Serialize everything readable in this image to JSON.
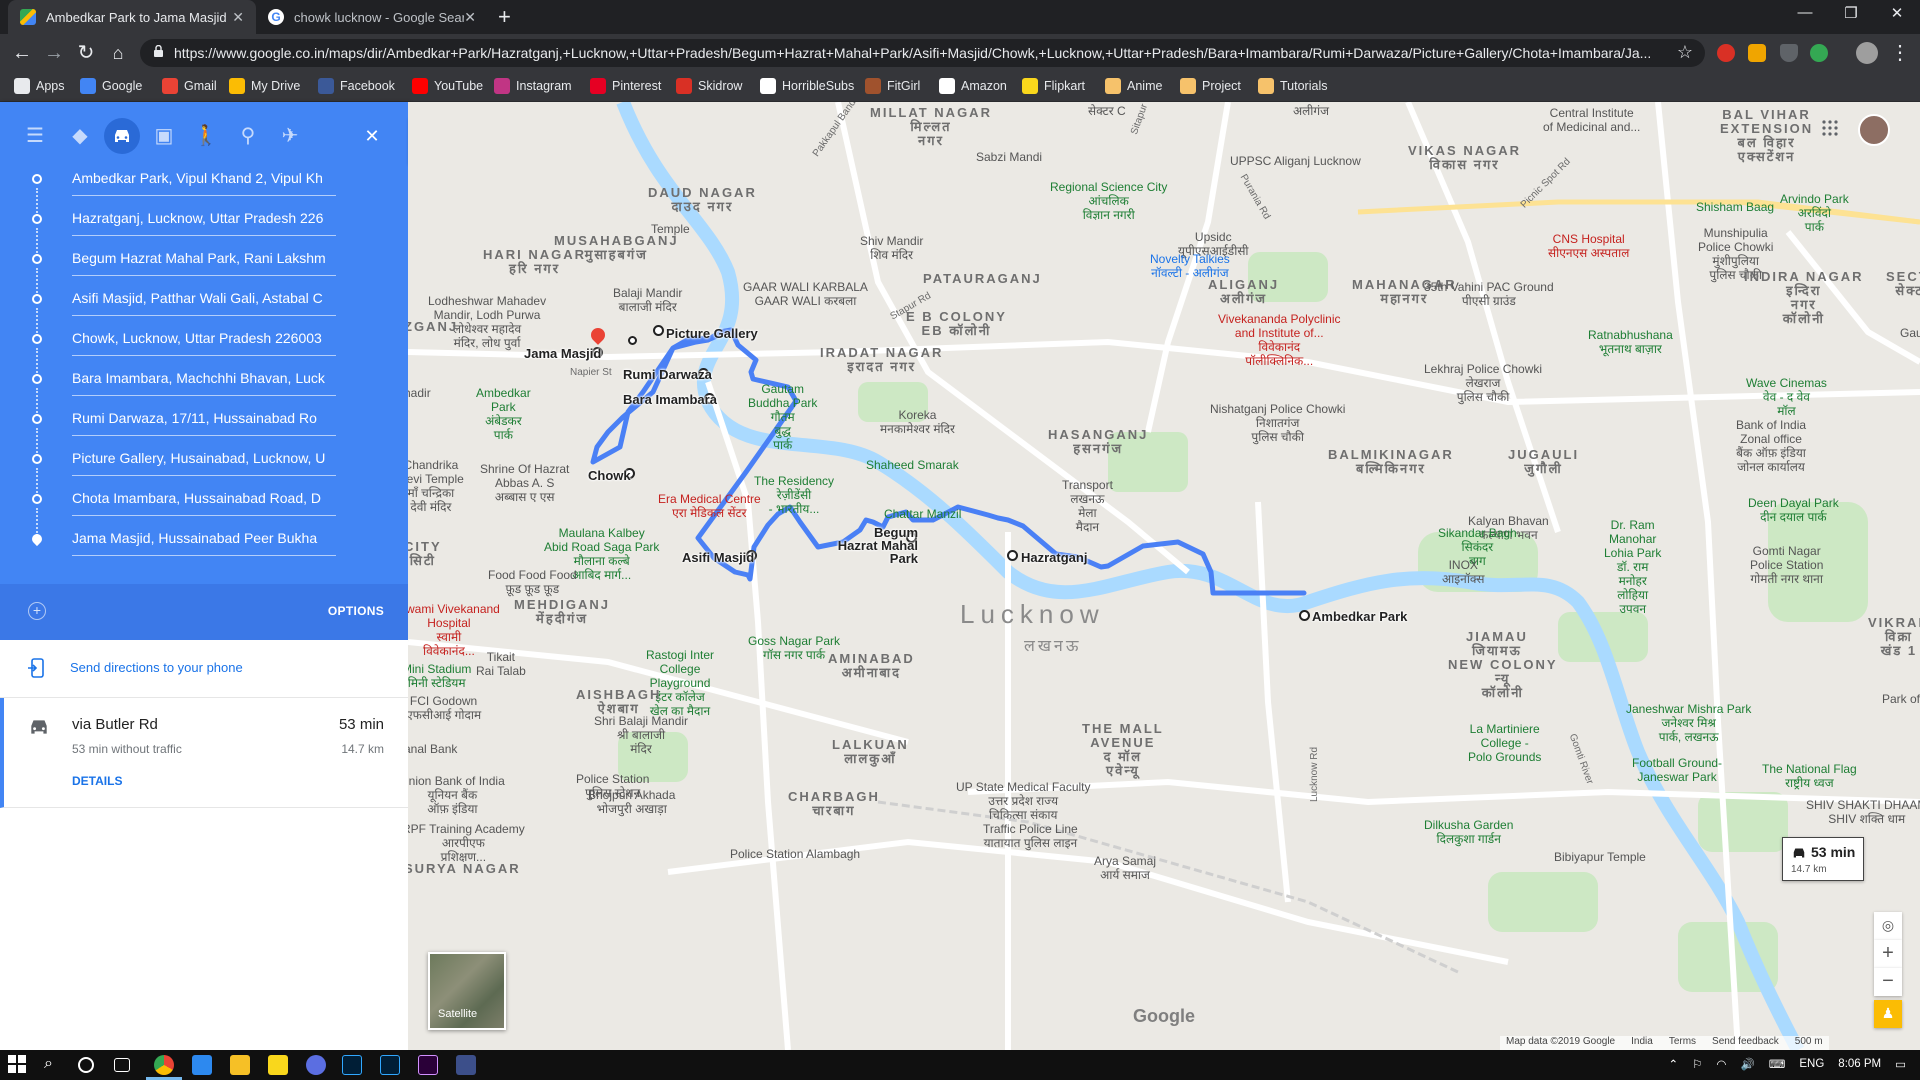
{
  "browser": {
    "tabs": [
      {
        "title": "Ambedkar Park to Jama Masjid -",
        "icon": "google-maps-icon",
        "active": true
      },
      {
        "title": "chowk lucknow - Google Search",
        "icon": "google-icon",
        "active": false
      }
    ],
    "new_tab": "+",
    "url": "https://www.google.co.in/maps/dir/Ambedkar+Park/Hazratganj,+Lucknow,+Uttar+Pradesh/Begum+Hazrat+Mahal+Park/Asifi+Masjid/Chowk,+Lucknow,+Uttar+Pradesh/Bara+Imambara/Rumi+Darwaza/Picture+Gallery/Chota+Imambara/Ja...",
    "bookmarks": [
      {
        "label": "Apps",
        "color": "#e8eaed"
      },
      {
        "label": "Google",
        "color": "#4285f4"
      },
      {
        "label": "Gmail",
        "color": "#ea4335"
      },
      {
        "label": "My Drive",
        "color": "#fbbc04"
      },
      {
        "label": "Facebook",
        "color": "#3b5998"
      },
      {
        "label": "YouTube",
        "color": "#ff0000"
      },
      {
        "label": "Instagram",
        "color": "#c13584"
      },
      {
        "label": "Pinterest",
        "color": "#e60023"
      },
      {
        "label": "Skidrow",
        "color": "#d93025"
      },
      {
        "label": "HorribleSubs",
        "color": "#ffffff"
      },
      {
        "label": "FitGirl",
        "color": "#a0522d"
      },
      {
        "label": "Amazon",
        "color": "#ffffff"
      },
      {
        "label": "Flipkart",
        "color": "#f9d71c"
      },
      {
        "label": "Anime",
        "color": "#f6c26b"
      },
      {
        "label": "Project",
        "color": "#f6c26b"
      },
      {
        "label": "Tutorials",
        "color": "#f6c26b"
      }
    ]
  },
  "directions": {
    "close_label": "✕",
    "stops": [
      "Ambedkar Park, Vipul Khand 2, Vipul Kh",
      "Hazratganj, Lucknow, Uttar Pradesh 226",
      "Begum Hazrat Mahal Park, Rani Lakshm",
      "Asifi Masjid, Patthar Wali Gali, Astabal C",
      "Chowk, Lucknow, Uttar Pradesh 226003",
      "Bara Imambara, Machchhi Bhavan, Luck",
      "Rumi Darwaza, 17/11, Hussainabad Ro",
      "Picture Gallery, Husainabad, Lucknow, U",
      "Chota Imambara, Hussainabad Road, D",
      "Jama Masjid, Hussainabad Peer Bukha"
    ],
    "options_label": "OPTIONS",
    "send_label": "Send directions to your phone",
    "route": {
      "via": "via Butler Rd",
      "time": "53 min",
      "without_traffic": "53 min without traffic",
      "distance": "14.7 km",
      "details_label": "DETAILS"
    }
  },
  "map": {
    "city_label": "Lucknow",
    "city_label_hi": "लखनऊ",
    "stop_labels": {
      "picture_gallery": "Picture Gallery",
      "jama_masjid": "Jama Masjid",
      "rumi_darwaza": "Rumi Darwaza",
      "bara_imambara": "Bara Imambara",
      "chowk": "Chowk",
      "asifi_masjid": "Asifi Masjid",
      "begum_hazrat": "Begum Hazrat Mahal Park",
      "hazratganj": "Hazratganj",
      "ambedkar_park": "Ambedkar Park"
    },
    "timebox": {
      "time": "53 min",
      "distance": "14.7 km"
    },
    "labels": {
      "millat_nagar": "MILLAT NAGAR\nमिल्लत\nनगर",
      "sector_c": "सेक्टर C",
      "aliganj_top": "अलीगंज",
      "central_institute": "Central Institute\nof Medicinal and...",
      "balvihar": "BAL VIHAR\nEXTENSION\nबल विहार\nएक्सटेंशन",
      "vikas_nagar": "VIKAS NAGAR\nविकास नगर",
      "daud_nagar": "DAUD NAGAR\nदाउद नगर",
      "sabzi_mandi": "Sabzi Mandi",
      "uppsc": "UPPSC Aliganj Lucknow",
      "regional_science": "Regional Science City\nआंचलिक\nविज्ञान नगरी",
      "cns_hospital": "CNS Hospital\nसीएनएस अस्पताल",
      "arvindo_park": "Arvindo Park\nअरविंदो\nपार्क",
      "shisham_baag": "Shisham Baag",
      "munshipulia": "Munshipulia\nPolice Chowki\nमुंशीपुलिया\nपुलिस चौकी",
      "temple": "Temple",
      "shiv_mandir": "Shiv Mandir\nशिव मंदिर",
      "upsidc": "Upsidc\nयूपीएसआईडीसी",
      "novelty_talkies": "Novelty Talkies\nनॉवल्टी - अलीगंज",
      "musahabganj": "MUSAHABGANJ\nमुसाहबगंज",
      "hari_nagar": "HARI NAGAR\nहरि नगर",
      "balaji_mandir": "Balaji Mandir\nबालाजी मंदिर",
      "lodhe": "Lodheshwar Mahadev\nMandir, Lodh Purwa\nलोधेश्वर महादेव\nमंदिर, लोध पुर्वा",
      "gaar_wali": "GAAR WALI KARBALA\nGAAR WALI करबला",
      "patauraganj": "PATAURAGANJ",
      "aliganj": "ALIGANJ\nअलीगंज",
      "mahanagar": "MAHANAGAR\nमहानगर",
      "vahini": "35th Vahini PAC Ground\nपीएसी ग्राउंड",
      "indira_nagar": "INDIRA NAGAR\nइन्दिरा\nनगर\nकॉलोनी",
      "sector_right": "SECTO\nसेक्टर",
      "eb_colony": "E B COLONY\nEB कॉलोनी",
      "iradat_nagar": "IRADAT NAGAR\nइरादत नगर",
      "vivekananda": "Vivekananda Polyclinic\nand Institute of...\nविवेकानंद\nपॉलीक्लिनिक...",
      "ratnabhushana": "Ratnabhushana\nभूतनाथ बाज़ार",
      "lekhraj": "Lekhraj Police Chowki\nलेखराज\nपुलिस चौकी",
      "wave_cinemas": "Wave Cinemas\nवेव - द वेव\nमॉल",
      "ambedkar_park_left": "Ambedkar\nPark\nअंबेडकर\nपार्क",
      "gautam_buddha": "Gautam\nBuddha Park\nगौतम\nबुद्ध\nपार्क",
      "koreka": "Koreka\nमनकामेश्वर मंदिर",
      "nishatganj": "Nishatganj Police Chowki\nनिशातगंज\nपुलिस चौकी",
      "hasanganj": "HASANGANJ\nहसनगंज",
      "bank_of_india": "Bank of India\nZonal office\nबैंक ऑफ़ इंडिया\nजोनल कार्यालय",
      "chandrika": "Chandrika\nDevi Temple\nमाँ चन्द्रिका\nदेवी मंदिर",
      "shrine": "Shrine Of Hazrat\nAbbas A. S\nअब्बास ए एस",
      "shaheed_smarak": "Shaheed Smarak",
      "balmikinagar": "BALMIKINAGAR\nबल्मिकिनगर",
      "jugauli": "JUGAULI\nजुगौली",
      "era_medical": "Era Medical Centre\nएरा मेडिकल सेंटर",
      "residency": "The Residency\nरेज़ीडेंसी\n- भारतीय...",
      "transport": "Transport\nलखनऊ\nमेला\nमैदान",
      "kalyan_bhavan": "Kalyan Bhavan\nकल्याण भवन",
      "deen_dayal": "Deen Dayal Park\nदीन दयाल पार्क",
      "chattar_manzil": "Chattar Manzil",
      "maulana": "Maulana Kalbey\nAbid Road Saga Park\nमौलाना कल्बे\nआबिद मार्ग...",
      "sikandar_bagh": "Sikandar Bagh\nसिकंदर\nबाग",
      "ram_manohar": "Dr. Ram\nManohar\nLohia Park\nडॉ. राम\nमनोहर\nलोहिया\nउपवन",
      "gomti_nagar_ps": "Gomti Nagar\nPolice Station\nगोमती नगर थाना",
      "city": "CITY\nसिटी",
      "food_food": "Food Food Food\nफ़ूड फ़ूड फ़ूड",
      "mehdiganj": "MEHDIGANJ\nमेंहदीगंज",
      "swami_hosp": "Swami Vivekanand\nHospital\nस्वामी\nविवेकानंद...",
      "inox": "INOX\nआइनॉक्स",
      "jiamau": "JIAMAU\nजियामऊ",
      "new_colony": "NEW COLONY\nन्यू\nकॉलोनी",
      "vikrant": "VIKRAN\nविक्रा\nखंड 1",
      "park_of": "Park of",
      "tikait": "Tikait\nRai Talab",
      "rastogi": "Rastogi Inter\nCollege\nPlayground\nइंटर कॉलेज\nखेल का मैदान",
      "goss_nagar": "Goss Nagar Park\nगॉस नगर पार्क",
      "aminabad": "AMINABAD\nअमीनाबाद",
      "stadium": "Mini Stadium\nमिनी स्टेडियम",
      "fci": "FCI Godown\nएफसीआई गोदाम",
      "aishbagh": "AISHBAGH\nऐशबाग",
      "shri_balaji": "Shri Balaji Mandir\nश्री बालाजी\nमंदिर",
      "the_mall": "THE MALL\nAVENUE\nद मॉल\nएवेन्यू",
      "la_martiniere": "La Martiniere\nCollege -\nPolo Grounds",
      "janeshwar": "Janeshwar Mishra Park\nजनेश्वर मिश्र\nपार्क, लखनऊ",
      "lalkuan": "LALKUAN\nलालकुआँ",
      "football_ground": "Football Ground-\nJaneswar Park",
      "national_flag": "The National Flag\nराष्ट्रीय ध्वज",
      "union_bank": "Union Bank of India\nयूनियन बैंक\nऑफ़ इंडिया",
      "police_station": "Police Station\nपुलिस स्टेशन",
      "bhojpuri": "Bhojpuri Akhada\nभोजपुरी अखाड़ा",
      "charbagh": "CHARBAGH\nचारबाग",
      "up_state": "UP State Medical Faculty\nउत्तर प्रदेश राज्य\nचिकित्सा संकाय",
      "dilkusha": "Dilkusha Garden\nदिलकुशा गार्डन",
      "shiv_shakti": "SHIV SHAKTI DHAAM\nSHIV शक्ति धाम",
      "rpf": "RPF Training Academy\nआरपीएफ\nप्रशिक्षण...",
      "traffic_police": "Traffic Police Line\nयातायात पुलिस लाइन",
      "police_alambagh": "Police Station Alambagh",
      "arya_samaj": "Arya Samaj\nआर्य समाज",
      "bibiyapur": "Bibiyapur Temple",
      "surya_nagar": "SURYA NAGAR",
      "anand_bank": "anal Bank",
      "gomti_river": "Gomti River",
      "napier": "Napier St",
      "stapur_rd": "Stapur Rd",
      "picnic_spot": "Picnic Spot Rd",
      "purania": "Purania Rd",
      "pakkapul": "Pakkapul Bandha Rd",
      "sitapur_rd": "Sitapur Rd",
      "zganj": "ZGANJ",
      "hadir": "hadir",
      "gau": "Gau",
      "lucknow_rd": "Lucknow Rd"
    },
    "satellite_label": "Satellite",
    "google_logo": "Google",
    "attribution": [
      "Map data ©2019 Google",
      "India",
      "Terms",
      "Send feedback",
      "500 m"
    ]
  },
  "taskbar": {
    "lang": "ENG",
    "time": "8:06 PM"
  }
}
